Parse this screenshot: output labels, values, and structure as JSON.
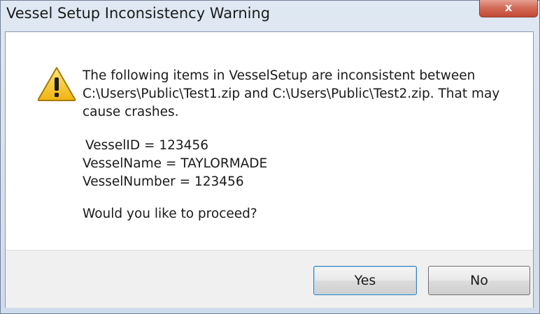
{
  "window": {
    "title": "Vessel Setup Inconsistency Warning",
    "close_symbol": "x"
  },
  "message": {
    "lines": [
      "The following items in VesselSetup are inconsistent between",
      "C:\\Users\\Public\\Test1.zip and C:\\Users\\Public\\Test2.zip. That may",
      "cause crashes."
    ],
    "items": [
      "VesselID = 123456",
      "VesselName = TAYLORMADE",
      "VesselNumber = 123456"
    ],
    "question": "Would you like to proceed?"
  },
  "icon": "warning-triangle-icon",
  "buttons": {
    "yes_label": "Yes",
    "no_label": "No"
  },
  "colors": {
    "close_button": "#c24a36",
    "warning_icon_fill": "#f5c518",
    "default_button_border": "#3c7fb1"
  }
}
